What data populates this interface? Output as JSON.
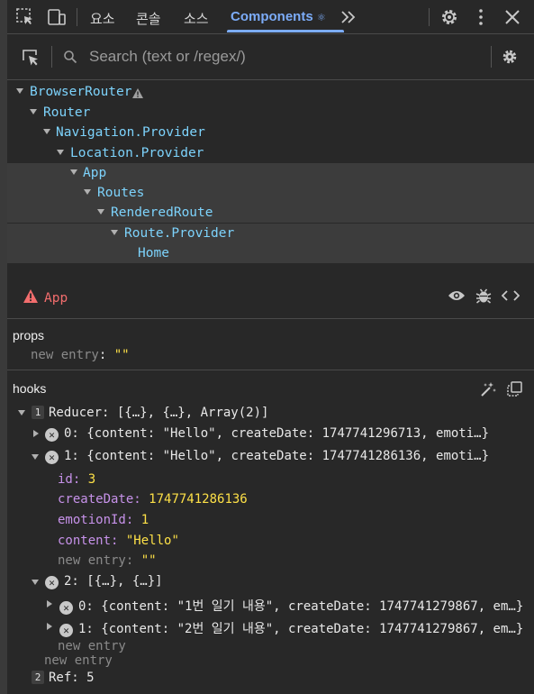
{
  "tabs": [
    {
      "label": "요소"
    },
    {
      "label": "콘솔"
    },
    {
      "label": "소스"
    },
    {
      "label": "Components",
      "badge": "⚛"
    }
  ],
  "search": {
    "placeholder": "Search (text or /regex/)"
  },
  "tree": [
    {
      "name": "BrowserRouter",
      "warning": true
    },
    {
      "name": "Router"
    },
    {
      "name": "Navigation.Provider"
    },
    {
      "name": "Location.Provider"
    },
    {
      "name": "App",
      "selected": true
    },
    {
      "name": "Routes"
    },
    {
      "name": "RenderedRoute"
    },
    {
      "name": "Route.Provider"
    },
    {
      "name": "Home"
    }
  ],
  "selected": {
    "name": "App"
  },
  "props": {
    "title": "props",
    "new_entry_key": "new entry",
    "new_entry_value": "\"\""
  },
  "hooks": {
    "title": "hooks",
    "reducer": {
      "index": "1",
      "label": "Reducer:",
      "summary": "[{…}, {…}, Array(2)]"
    },
    "item0": {
      "key": "0:",
      "summary": "{content: \"Hello\", createDate: 1747741296713, emoti…}"
    },
    "item1": {
      "key": "1:",
      "summary": "{content: \"Hello\", createDate: 1747741286136, emoti…}"
    },
    "item1_fields": {
      "id_key": "id:",
      "id_val": "3",
      "cd_key": "createDate:",
      "cd_val": "1747741286136",
      "em_key": "emotionId:",
      "em_val": "1",
      "ct_key": "content:",
      "ct_val": "\"Hello\"",
      "ne_key": "new entry:",
      "ne_val": "\"\""
    },
    "item2": {
      "key": "2:",
      "summary": "[{…}, {…}]"
    },
    "item2_0": {
      "key": "0:",
      "summary": "{content: \"1번 일기 내용\", createDate: 1747741279867, em…}"
    },
    "item2_1": {
      "key": "1:",
      "summary": "{content: \"2번 일기 내용\", createDate: 1747741279867, em…}"
    },
    "new_entry_inner": "new entry",
    "new_entry_outer": "new entry",
    "ref": {
      "index": "2",
      "label": "Ref:",
      "value": "5"
    }
  }
}
